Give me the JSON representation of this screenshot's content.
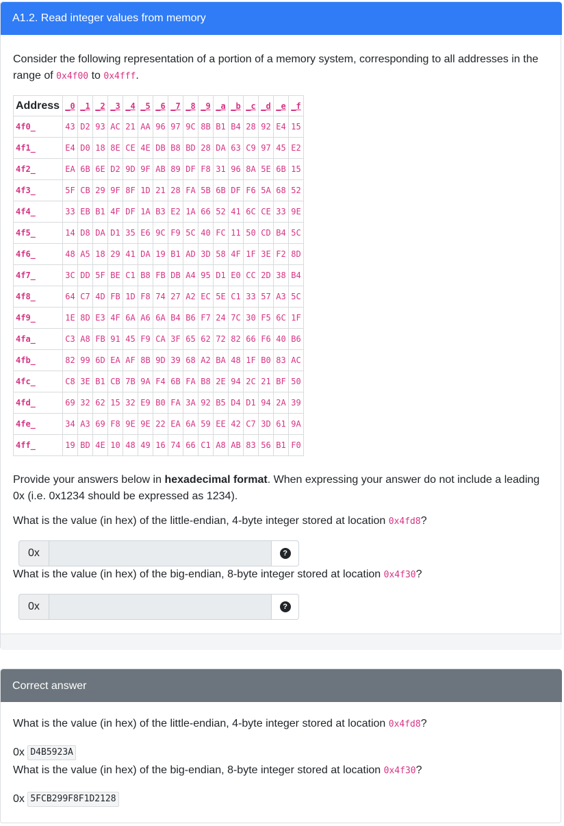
{
  "question": {
    "title": "A1.2. Read integer values from memory",
    "intro_text": "Consider the following representation of a portion of a memory system, corresponding to all addresses in the range of",
    "range_start": "0x4f00",
    "range_to": "to",
    "range_end": "0x4fff",
    "range_end_punct": "."
  },
  "memory_table": {
    "address_header": "Address",
    "column_headers": [
      "_0",
      "_1",
      "_2",
      "_3",
      "_4",
      "_5",
      "_6",
      "_7",
      "_8",
      "_9",
      "_a",
      "_b",
      "_c",
      "_d",
      "_e",
      "_f"
    ],
    "rows": [
      {
        "address": "4f0_",
        "bytes": [
          "43",
          "D2",
          "93",
          "AC",
          "21",
          "AA",
          "96",
          "97",
          "9C",
          "8B",
          "B1",
          "B4",
          "28",
          "92",
          "E4",
          "15"
        ]
      },
      {
        "address": "4f1_",
        "bytes": [
          "E4",
          "D0",
          "18",
          "8E",
          "CE",
          "4E",
          "DB",
          "B8",
          "BD",
          "28",
          "DA",
          "63",
          "C9",
          "97",
          "45",
          "E2"
        ]
      },
      {
        "address": "4f2_",
        "bytes": [
          "EA",
          "6B",
          "6E",
          "D2",
          "9D",
          "9F",
          "AB",
          "89",
          "DF",
          "F8",
          "31",
          "96",
          "8A",
          "5E",
          "6B",
          "15"
        ]
      },
      {
        "address": "4f3_",
        "bytes": [
          "5F",
          "CB",
          "29",
          "9F",
          "8F",
          "1D",
          "21",
          "28",
          "FA",
          "5B",
          "6B",
          "DF",
          "F6",
          "5A",
          "68",
          "52"
        ]
      },
      {
        "address": "4f4_",
        "bytes": [
          "33",
          "EB",
          "B1",
          "4F",
          "DF",
          "1A",
          "B3",
          "E2",
          "1A",
          "66",
          "52",
          "41",
          "6C",
          "CE",
          "33",
          "9E"
        ]
      },
      {
        "address": "4f5_",
        "bytes": [
          "14",
          "D8",
          "DA",
          "D1",
          "35",
          "E6",
          "9C",
          "F9",
          "5C",
          "40",
          "FC",
          "11",
          "50",
          "CD",
          "B4",
          "5C"
        ]
      },
      {
        "address": "4f6_",
        "bytes": [
          "48",
          "A5",
          "18",
          "29",
          "41",
          "DA",
          "19",
          "B1",
          "AD",
          "3D",
          "58",
          "4F",
          "1F",
          "3E",
          "F2",
          "8D"
        ]
      },
      {
        "address": "4f7_",
        "bytes": [
          "3C",
          "DD",
          "5F",
          "BE",
          "C1",
          "B8",
          "FB",
          "DB",
          "A4",
          "95",
          "D1",
          "E0",
          "CC",
          "2D",
          "38",
          "B4"
        ]
      },
      {
        "address": "4f8_",
        "bytes": [
          "64",
          "C7",
          "4D",
          "FB",
          "1D",
          "F8",
          "74",
          "27",
          "A2",
          "EC",
          "5E",
          "C1",
          "33",
          "57",
          "A3",
          "5C"
        ]
      },
      {
        "address": "4f9_",
        "bytes": [
          "1E",
          "8D",
          "E3",
          "4F",
          "6A",
          "A6",
          "6A",
          "B4",
          "B6",
          "F7",
          "24",
          "7C",
          "30",
          "F5",
          "6C",
          "1F"
        ]
      },
      {
        "address": "4fa_",
        "bytes": [
          "C3",
          "A8",
          "FB",
          "91",
          "45",
          "F9",
          "CA",
          "3F",
          "65",
          "62",
          "72",
          "82",
          "66",
          "F6",
          "40",
          "B6"
        ]
      },
      {
        "address": "4fb_",
        "bytes": [
          "82",
          "99",
          "6D",
          "EA",
          "AF",
          "8B",
          "9D",
          "39",
          "68",
          "A2",
          "BA",
          "48",
          "1F",
          "B0",
          "83",
          "AC"
        ]
      },
      {
        "address": "4fc_",
        "bytes": [
          "C8",
          "3E",
          "B1",
          "CB",
          "7B",
          "9A",
          "F4",
          "6B",
          "FA",
          "B8",
          "2E",
          "94",
          "2C",
          "21",
          "BF",
          "50"
        ]
      },
      {
        "address": "4fd_",
        "bytes": [
          "69",
          "32",
          "62",
          "15",
          "32",
          "E9",
          "B0",
          "FA",
          "3A",
          "92",
          "B5",
          "D4",
          "D1",
          "94",
          "2A",
          "39"
        ]
      },
      {
        "address": "4fe_",
        "bytes": [
          "34",
          "A3",
          "69",
          "F8",
          "9E",
          "9E",
          "22",
          "EA",
          "6A",
          "59",
          "EE",
          "42",
          "C7",
          "3D",
          "61",
          "9A"
        ]
      },
      {
        "address": "4ff_",
        "bytes": [
          "19",
          "BD",
          "4E",
          "10",
          "48",
          "49",
          "16",
          "74",
          "66",
          "C1",
          "A8",
          "AB",
          "83",
          "56",
          "B1",
          "F0"
        ]
      }
    ]
  },
  "instructions": {
    "before": "Provide your answers below in",
    "bold": "hexadecimal format",
    "after": ". When expressing your answer do not include a leading 0x (i.e. 0x1234 should be expressed as 1234)."
  },
  "q1": {
    "text": "What is the value (in hex) of the little-endian, 4-byte integer stored at location",
    "location": "0x4fd8",
    "punct": "?",
    "prefix": "0x",
    "value": ""
  },
  "q2": {
    "text": "What is the value (in hex) of the big-endian, 8-byte integer stored at location",
    "location": "0x4f30",
    "punct": "?",
    "prefix": "0x",
    "value": ""
  },
  "help_icon": "question-circle-icon",
  "help_glyph": "?",
  "correct": {
    "title": "Correct answer",
    "a1": {
      "text": "What is the value (in hex) of the little-endian, 4-byte integer stored at location",
      "location": "0x4fd8",
      "punct": "?",
      "prefix": "0x",
      "answer": "D4B5923A"
    },
    "a2": {
      "text": "What is the value (in hex) of the big-endian, 8-byte integer stored at location",
      "location": "0x4f30",
      "punct": "?",
      "prefix": "0x",
      "answer": "5FCB299F8F1D2128"
    }
  },
  "colors": {
    "header_blue": "#2f7cf6",
    "header_gray": "#6c757d",
    "code_pink": "#d63384"
  }
}
